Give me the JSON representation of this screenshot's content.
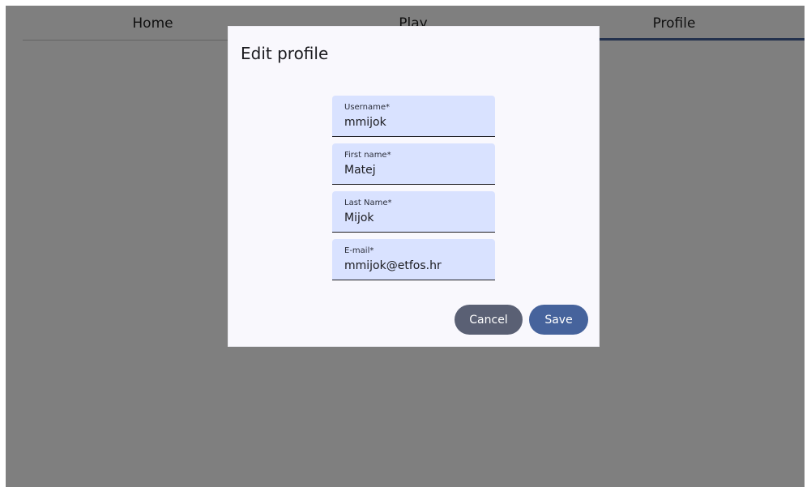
{
  "tabs": [
    {
      "label": "Home"
    },
    {
      "label": "Play"
    },
    {
      "label": "Profile"
    }
  ],
  "active_tab": "Profile",
  "dialog": {
    "title": "Edit profile",
    "fields": [
      {
        "label": "Username*",
        "value": "mmijok"
      },
      {
        "label": "First name*",
        "value": "Matej"
      },
      {
        "label": "Last Name*",
        "value": "Mijok"
      },
      {
        "label": "E-mail*",
        "value": "mmijok@etfos.hr"
      }
    ],
    "cancel_label": "Cancel",
    "save_label": "Save"
  },
  "colors": {
    "accent": "#47639b",
    "field_bg": "#d9e2ff",
    "cancel_bg": "#5a6074",
    "save_bg": "#46639c",
    "scrim": "rgba(0,0,0,0.5)"
  }
}
